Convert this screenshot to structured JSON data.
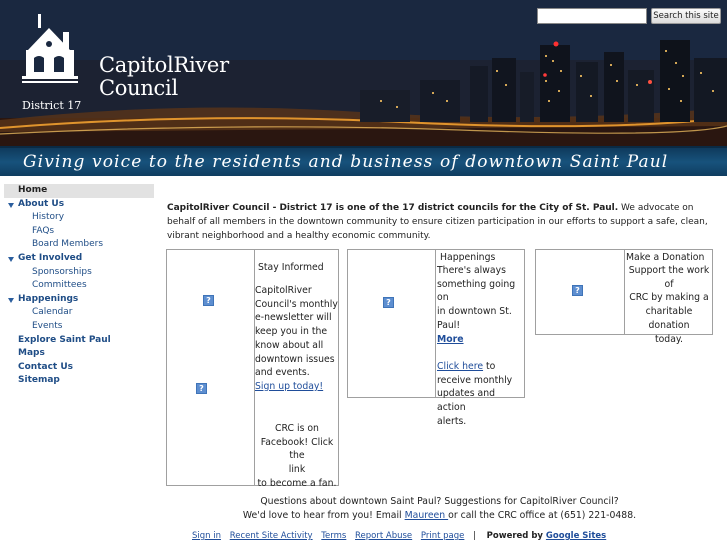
{
  "search": {
    "placeholder": "",
    "button_label": "Search this site"
  },
  "header": {
    "org_line1": "CapitolRiver",
    "org_line2": "Council",
    "district": "District 17",
    "tagline": "Giving voice to the residents and business of downtown Saint Paul"
  },
  "sidebar": {
    "home": "Home",
    "about": {
      "label": "About Us",
      "items": [
        "History",
        "FAQs",
        "Board Members"
      ]
    },
    "involved": {
      "label": "Get Involved",
      "items": [
        "Sponsorships",
        "Committees"
      ]
    },
    "happenings": {
      "label": "Happenings",
      "items": [
        "Calendar",
        "Events"
      ]
    },
    "explore": "Explore Saint Paul",
    "maps": "Maps",
    "contact": "Contact Us",
    "sitemap": "Sitemap"
  },
  "intro": {
    "bold": "CapitolRiver Council - District 17 is one of the 17 district councils for the City of St. Paul.",
    "rest": "  We advocate on behalf of all members in the downtown community to ensure citizen participation in our efforts to support a safe, clean, vibrant neighborhood and a healthy economic community."
  },
  "box1": {
    "heading": "Stay Informed",
    "lines": [
      "CapitolRiver",
      "Council's monthly",
      "e-newsletter will",
      "keep you in the",
      "know about all",
      "downtown issues",
      "and events."
    ],
    "link": "Sign up today!",
    "fb_lines": [
      "CRC is on",
      "Facebook! Click the",
      "link",
      "to become a fan."
    ]
  },
  "box2": {
    "heading": "Happenings",
    "lines": [
      "There's always",
      "something going on",
      "in downtown St.",
      "Paul!"
    ],
    "more": "More",
    "click_link": "Click here",
    "click_rest": " to",
    "tail_lines": [
      "receive monthly",
      "updates and action",
      "alerts."
    ]
  },
  "box3": {
    "heading": "Make a Donation",
    "lines": [
      "Support the work of",
      "CRC by making a",
      "charitable donation",
      "today."
    ]
  },
  "footer": {
    "q1": "Questions about downtown Saint Paul? Suggestions for CapitolRiver Council?",
    "q2a": "We'd love to hear from you! Email ",
    "q2link": "Maureen ",
    "q2b": "or call the CRC office at (651) 221-0488.",
    "links": [
      "Sign in",
      "Recent Site Activity",
      "Terms",
      "Report Abuse",
      "Print page"
    ],
    "sep": "|",
    "powered": "Powered by ",
    "powered_link": "Google Sites"
  },
  "icons": {
    "placeholder": "broken-image-icon",
    "triangle": "disclosure-triangle-icon"
  },
  "colors": {
    "link": "#1f4d9a",
    "tagline_bg": "#17527c",
    "home_bg": "#e2e2e2"
  }
}
